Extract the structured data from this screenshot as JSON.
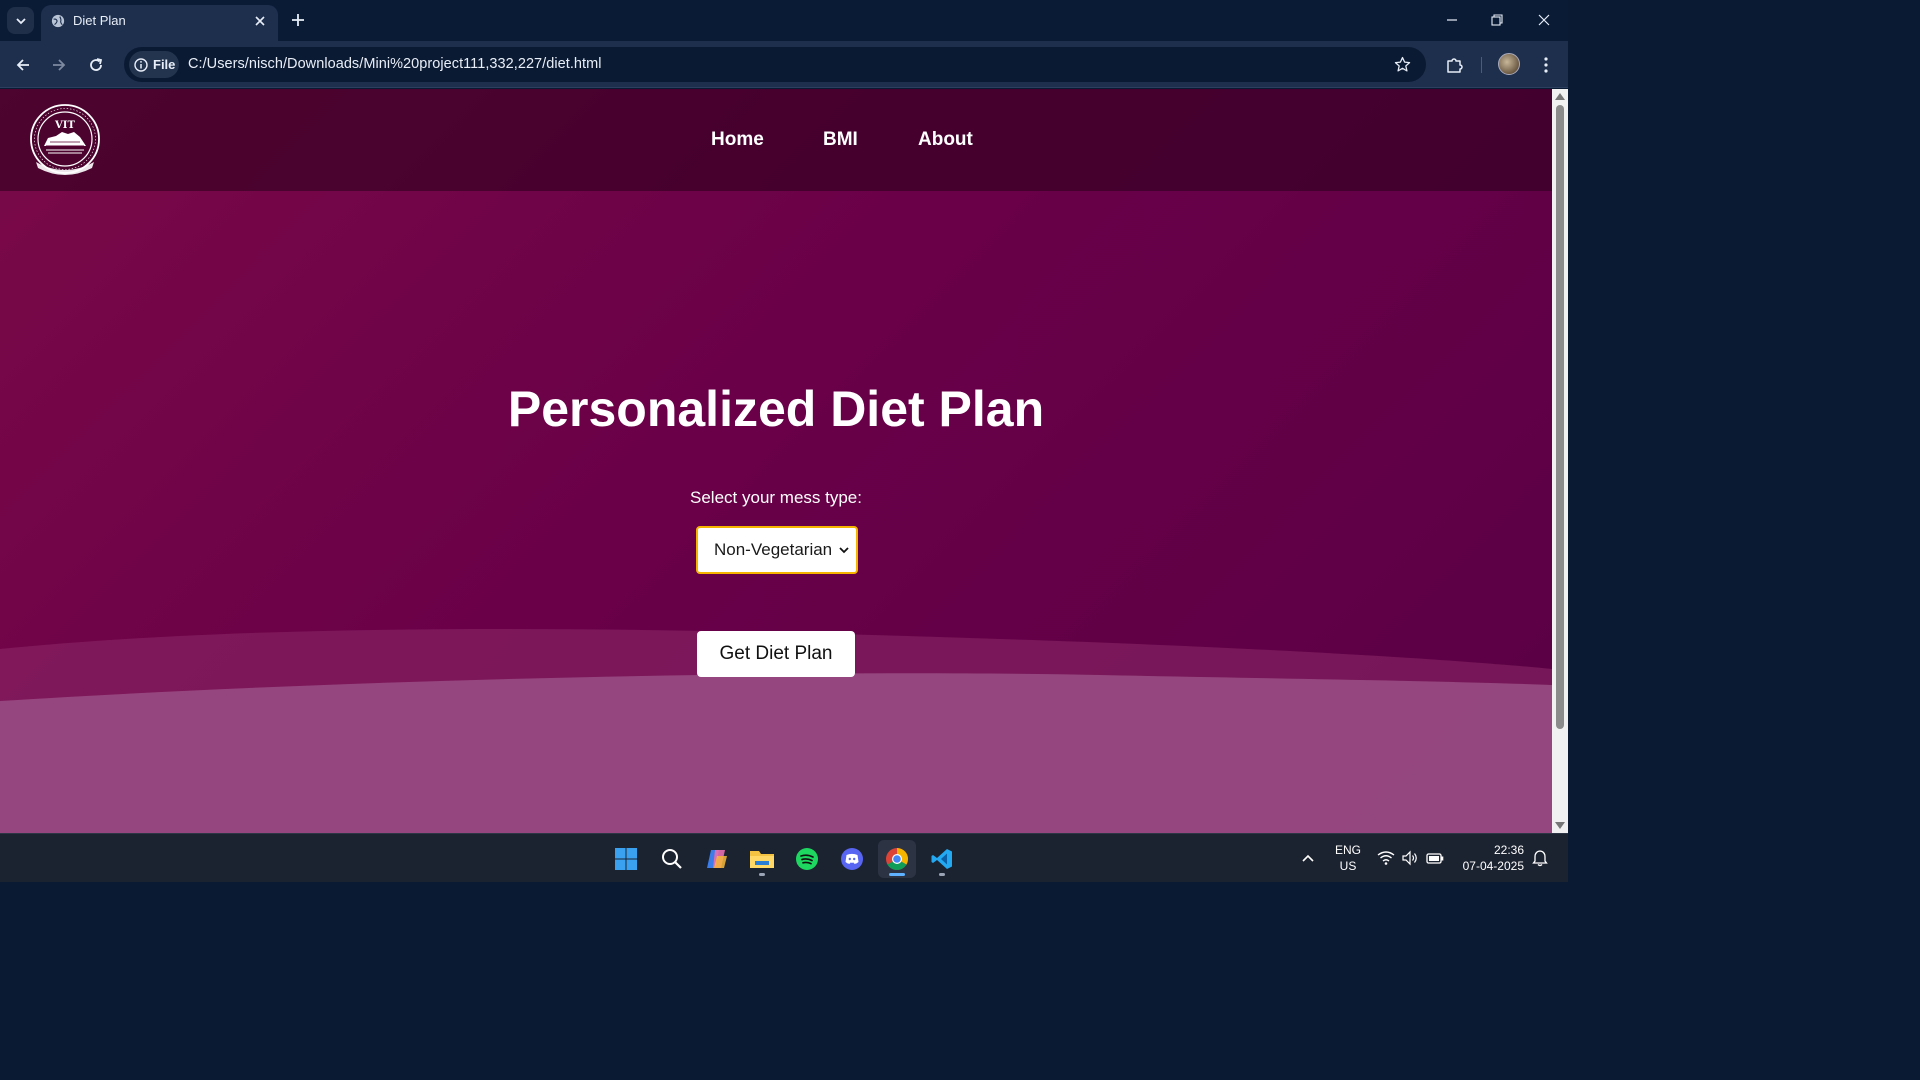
{
  "browser": {
    "tab_title": "Diet Plan",
    "site_info_label": "File",
    "url": "C:/Users/nisch/Downloads/Mini%20project111,332,227/diet.html"
  },
  "site": {
    "logo_text": "VIT",
    "nav": [
      {
        "label": "Home"
      },
      {
        "label": "BMI"
      },
      {
        "label": "About"
      }
    ],
    "heading": "Personalized Diet Plan",
    "select_label": "Select your mess type:",
    "mess_type_value": "Non-Vegetarian",
    "submit_label": "Get Diet Plan"
  },
  "colors": {
    "page_gradient": [
      "#7a0a48",
      "#5a0045"
    ],
    "select_border": "#f5b400"
  },
  "taskbar": {
    "apps": [
      "windows-start",
      "search",
      "copilot",
      "file-explorer",
      "spotify",
      "discord",
      "chrome",
      "vscode"
    ],
    "language": "ENG",
    "region": "US",
    "time": "22:36",
    "date": "07-04-2025"
  }
}
